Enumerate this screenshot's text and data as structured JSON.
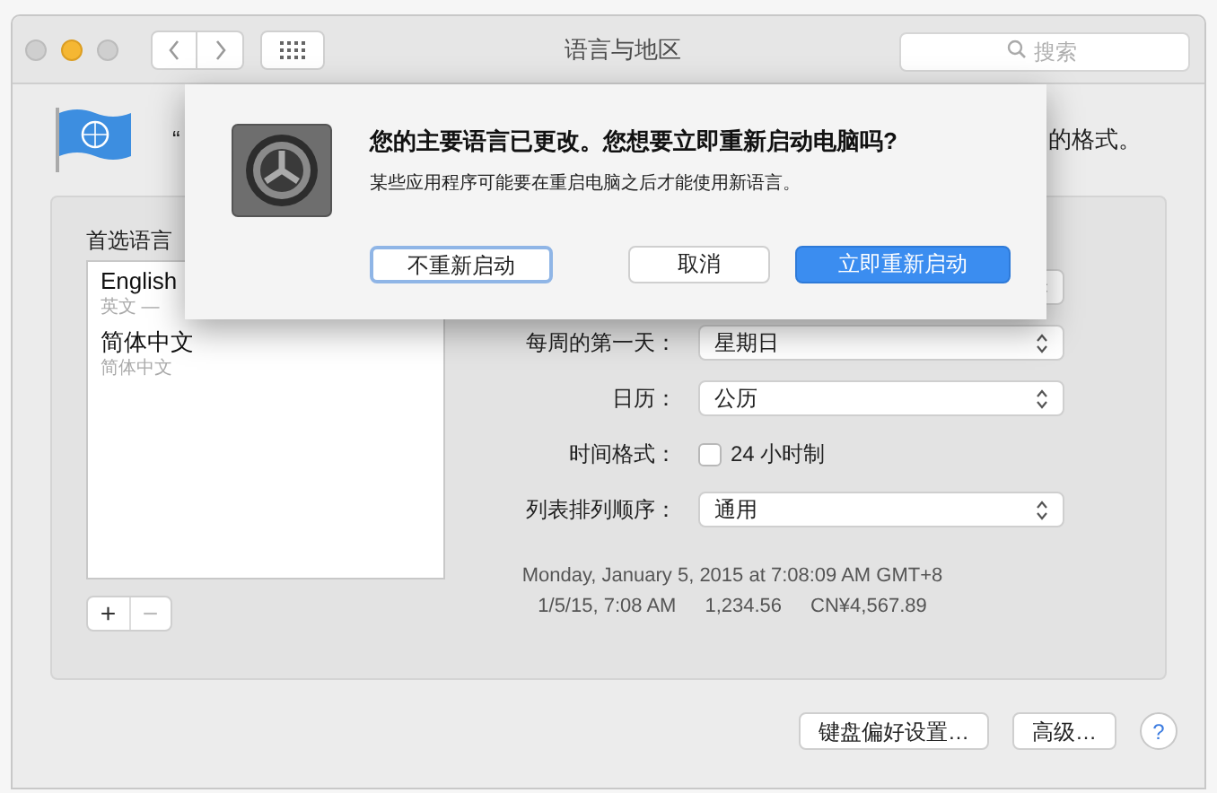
{
  "window": {
    "title": "语言与地区"
  },
  "toolbar": {
    "search": {
      "placeholder": "搜索"
    }
  },
  "header": {
    "text_start": "“",
    "text_end": "的格式。"
  },
  "preferred_languages": {
    "label": "首选语言",
    "items": [
      {
        "name": "English",
        "detail": "英文 —"
      },
      {
        "name": "简体中文",
        "detail": "简体中文"
      }
    ],
    "add_button": "+",
    "remove_button": "−"
  },
  "settings": [
    {
      "kind": "covered"
    },
    {
      "kind": "popup",
      "label": "每周的第一天：",
      "value": "星期日"
    },
    {
      "kind": "popup",
      "label": "日历：",
      "value": "公历"
    },
    {
      "kind": "checkbox",
      "label": "时间格式：",
      "text": "24 小时制",
      "checked": false
    },
    {
      "kind": "popup",
      "label": "列表排列顺序：",
      "value": "通用"
    }
  ],
  "format_preview": {
    "full_date": "Monday, January 5, 2015 at 7:08:09 AM GMT+8",
    "samples": [
      "1/5/15, 7:08 AM",
      "1,234.56",
      "CN¥4,567.89"
    ]
  },
  "buttons": [
    "键盘偏好设置…",
    "高级…"
  ],
  "help_button": "?",
  "dialog": {
    "title": "您的主要语言已更改。您想要立即重新启动电脑吗?",
    "message": "某些应用程序可能要在重启电脑之后才能使用新语言。",
    "buttons": [
      {
        "label": "不重新启动",
        "kind": "focused"
      },
      {
        "label": "取消",
        "kind": "normal"
      },
      {
        "label": "立即重新启动",
        "kind": "default"
      }
    ]
  }
}
